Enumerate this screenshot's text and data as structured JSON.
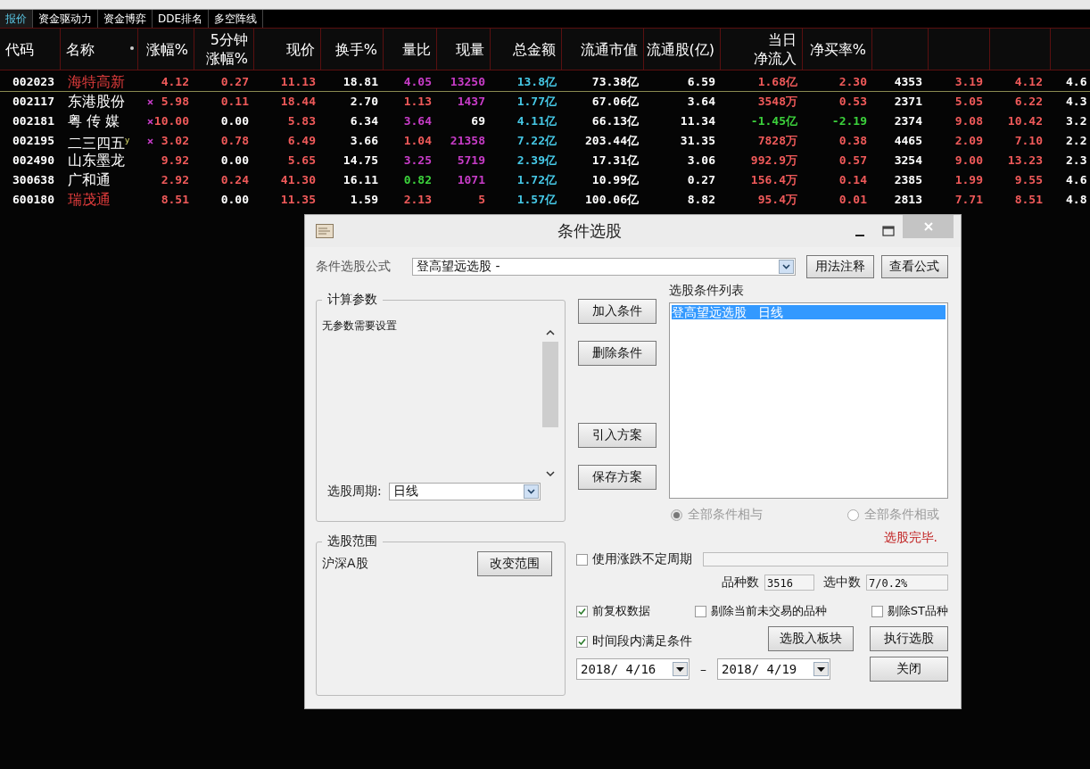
{
  "tabs": [
    {
      "label": "报价",
      "selected": true
    },
    {
      "label": "资金驱动力",
      "selected": false
    },
    {
      "label": "资金博弈",
      "selected": false
    },
    {
      "label": "DDE排名",
      "selected": false
    },
    {
      "label": "多空阵线",
      "selected": false
    }
  ],
  "table": {
    "columns": [
      {
        "lines": [
          "代码"
        ],
        "sorted": false
      },
      {
        "lines": [
          "名称"
        ],
        "sorted": true
      },
      {
        "lines": [
          "涨幅%"
        ],
        "sorted": false
      },
      {
        "lines": [
          "5分钟",
          "涨幅%"
        ],
        "sorted": false
      },
      {
        "lines": [
          "现价"
        ],
        "sorted": false
      },
      {
        "lines": [
          "换手%"
        ],
        "sorted": false
      },
      {
        "lines": [
          "量比"
        ],
        "sorted": false
      },
      {
        "lines": [
          "现量"
        ],
        "sorted": false
      },
      {
        "lines": [
          "总金额"
        ],
        "sorted": false
      },
      {
        "lines": [
          "流通市值"
        ],
        "sorted": false
      },
      {
        "lines": [
          "流通股(亿)"
        ],
        "sorted": false
      },
      {
        "lines": [
          "当日",
          "净流入"
        ],
        "sorted": false
      },
      {
        "lines": [
          "净买率%"
        ],
        "sorted": false
      }
    ],
    "rows": [
      {
        "marked": false,
        "selected": true,
        "cells": [
          {
            "text": "002023",
            "color": "#ffffff"
          },
          {
            "text": "海特高新",
            "color": "#e03c3c"
          },
          {
            "text": "4.12",
            "color": "#f05a5a"
          },
          {
            "text": "0.27",
            "color": "#f05a5a"
          },
          {
            "text": "11.13",
            "color": "#f05a5a"
          },
          {
            "text": "18.81",
            "color": "#ffffff"
          },
          {
            "text": "4.05",
            "color": "#c83cc8"
          },
          {
            "text": "13250",
            "color": "#c83cc8"
          },
          {
            "text": "13.8亿",
            "color": "#46c8e6"
          },
          {
            "text": "73.38亿",
            "color": "#ffffff"
          },
          {
            "text": "6.59",
            "color": "#ffffff"
          },
          {
            "text": "1.68亿",
            "color": "#f05a5a"
          },
          {
            "text": "2.30",
            "color": "#f05a5a"
          },
          {
            "text": "4353",
            "color": "#ffffff"
          },
          {
            "text": "3.19",
            "color": "#f05a5a"
          },
          {
            "text": "4.12",
            "color": "#f05a5a"
          },
          {
            "text": "4.6",
            "color": "#ffffff"
          }
        ]
      },
      {
        "marked": true,
        "selected": false,
        "cells": [
          {
            "text": "002117",
            "color": "#ffffff"
          },
          {
            "text": "东港股份",
            "color": "#ffffff"
          },
          {
            "text": "5.98",
            "color": "#f05a5a"
          },
          {
            "text": "0.11",
            "color": "#f05a5a"
          },
          {
            "text": "18.44",
            "color": "#f05a5a"
          },
          {
            "text": "2.70",
            "color": "#ffffff"
          },
          {
            "text": "1.13",
            "color": "#f05a5a"
          },
          {
            "text": "1437",
            "color": "#c83cc8"
          },
          {
            "text": "1.77亿",
            "color": "#46c8e6"
          },
          {
            "text": "67.06亿",
            "color": "#ffffff"
          },
          {
            "text": "3.64",
            "color": "#ffffff"
          },
          {
            "text": "3548万",
            "color": "#f05a5a"
          },
          {
            "text": "0.53",
            "color": "#f05a5a"
          },
          {
            "text": "2371",
            "color": "#ffffff"
          },
          {
            "text": "5.05",
            "color": "#f05a5a"
          },
          {
            "text": "6.22",
            "color": "#f05a5a"
          },
          {
            "text": "4.3",
            "color": "#ffffff"
          }
        ]
      },
      {
        "marked": true,
        "selected": false,
        "cells": [
          {
            "text": "002181",
            "color": "#ffffff"
          },
          {
            "text": "粤 传 媒",
            "color": "#ffffff"
          },
          {
            "text": "10.00",
            "color": "#f05a5a"
          },
          {
            "text": "0.00",
            "color": "#ffffff"
          },
          {
            "text": "5.83",
            "color": "#f05a5a"
          },
          {
            "text": "6.34",
            "color": "#ffffff"
          },
          {
            "text": "3.64",
            "color": "#c83cc8"
          },
          {
            "text": "69",
            "color": "#ffffff"
          },
          {
            "text": "4.11亿",
            "color": "#46c8e6"
          },
          {
            "text": "66.13亿",
            "color": "#ffffff"
          },
          {
            "text": "11.34",
            "color": "#ffffff"
          },
          {
            "text": "-1.45亿",
            "color": "#3cd23c"
          },
          {
            "text": "-2.19",
            "color": "#3cd23c"
          },
          {
            "text": "2374",
            "color": "#ffffff"
          },
          {
            "text": "9.08",
            "color": "#f05a5a"
          },
          {
            "text": "10.42",
            "color": "#f05a5a"
          },
          {
            "text": "3.2",
            "color": "#ffffff"
          }
        ]
      },
      {
        "marked": true,
        "selected": false,
        "cells": [
          {
            "text": "002195",
            "color": "#ffffff"
          },
          {
            "text": "二三四五$^{y}$",
            "color": "#ffffff"
          },
          {
            "text": "3.02",
            "color": "#f05a5a"
          },
          {
            "text": "0.78",
            "color": "#f05a5a"
          },
          {
            "text": "6.49",
            "color": "#f05a5a"
          },
          {
            "text": "3.66",
            "color": "#ffffff"
          },
          {
            "text": "1.04",
            "color": "#f05a5a"
          },
          {
            "text": "21358",
            "color": "#c83cc8"
          },
          {
            "text": "7.22亿",
            "color": "#46c8e6"
          },
          {
            "text": "203.44亿",
            "color": "#ffffff"
          },
          {
            "text": "31.35",
            "color": "#ffffff"
          },
          {
            "text": "7828万",
            "color": "#f05a5a"
          },
          {
            "text": "0.38",
            "color": "#f05a5a"
          },
          {
            "text": "4465",
            "color": "#ffffff"
          },
          {
            "text": "2.09",
            "color": "#f05a5a"
          },
          {
            "text": "7.10",
            "color": "#f05a5a"
          },
          {
            "text": "2.2",
            "color": "#ffffff"
          }
        ]
      },
      {
        "marked": false,
        "selected": false,
        "cells": [
          {
            "text": "002490",
            "color": "#ffffff"
          },
          {
            "text": "山东墨龙",
            "color": "#ffffff"
          },
          {
            "text": "9.92",
            "color": "#f05a5a"
          },
          {
            "text": "0.00",
            "color": "#ffffff"
          },
          {
            "text": "5.65",
            "color": "#f05a5a"
          },
          {
            "text": "14.75",
            "color": "#ffffff"
          },
          {
            "text": "3.25",
            "color": "#c83cc8"
          },
          {
            "text": "5719",
            "color": "#c83cc8"
          },
          {
            "text": "2.39亿",
            "color": "#46c8e6"
          },
          {
            "text": "17.31亿",
            "color": "#ffffff"
          },
          {
            "text": "3.06",
            "color": "#ffffff"
          },
          {
            "text": "992.9万",
            "color": "#f05a5a"
          },
          {
            "text": "0.57",
            "color": "#f05a5a"
          },
          {
            "text": "3254",
            "color": "#ffffff"
          },
          {
            "text": "9.00",
            "color": "#f05a5a"
          },
          {
            "text": "13.23",
            "color": "#f05a5a"
          },
          {
            "text": "2.3",
            "color": "#ffffff"
          }
        ]
      },
      {
        "marked": false,
        "selected": false,
        "cells": [
          {
            "text": "300638",
            "color": "#ffffff"
          },
          {
            "text": "广和通",
            "color": "#ffffff"
          },
          {
            "text": "2.92",
            "color": "#f05a5a"
          },
          {
            "text": "0.24",
            "color": "#f05a5a"
          },
          {
            "text": "41.30",
            "color": "#f05a5a"
          },
          {
            "text": "16.11",
            "color": "#ffffff"
          },
          {
            "text": "0.82",
            "color": "#3cd23c"
          },
          {
            "text": "1071",
            "color": "#c83cc8"
          },
          {
            "text": "1.72亿",
            "color": "#46c8e6"
          },
          {
            "text": "10.99亿",
            "color": "#ffffff"
          },
          {
            "text": "0.27",
            "color": "#ffffff"
          },
          {
            "text": "156.4万",
            "color": "#f05a5a"
          },
          {
            "text": "0.14",
            "color": "#f05a5a"
          },
          {
            "text": "2385",
            "color": "#ffffff"
          },
          {
            "text": "1.99",
            "color": "#f05a5a"
          },
          {
            "text": "9.55",
            "color": "#f05a5a"
          },
          {
            "text": "4.6",
            "color": "#ffffff"
          }
        ]
      },
      {
        "marked": false,
        "selected": false,
        "cells": [
          {
            "text": "600180",
            "color": "#ffffff"
          },
          {
            "text": "瑞茂通",
            "color": "#e03c3c"
          },
          {
            "text": "8.51",
            "color": "#f05a5a"
          },
          {
            "text": "0.00",
            "color": "#ffffff"
          },
          {
            "text": "11.35",
            "color": "#f05a5a"
          },
          {
            "text": "1.59",
            "color": "#ffffff"
          },
          {
            "text": "2.13",
            "color": "#f05a5a"
          },
          {
            "text": "5",
            "color": "#f05a5a"
          },
          {
            "text": "1.57亿",
            "color": "#46c8e6"
          },
          {
            "text": "100.06亿",
            "color": "#ffffff"
          },
          {
            "text": "8.82",
            "color": "#ffffff"
          },
          {
            "text": "95.4万",
            "color": "#f05a5a"
          },
          {
            "text": "0.01",
            "color": "#f05a5a"
          },
          {
            "text": "2813",
            "color": "#ffffff"
          },
          {
            "text": "7.71",
            "color": "#f05a5a"
          },
          {
            "text": "8.51",
            "color": "#f05a5a"
          },
          {
            "text": "4.8",
            "color": "#ffffff"
          }
        ]
      }
    ]
  },
  "dialog": {
    "title": "条件选股",
    "formula": {
      "label": "条件选股公式",
      "value": "登高望远选股 -"
    },
    "top_buttons": [
      "用法注释",
      "查看公式"
    ],
    "params": {
      "title": "计算参数",
      "text": "无参数需要设置",
      "period_label": "选股周期:",
      "period_value": "日线"
    },
    "scope": {
      "title": "选股范围",
      "value": "沪深A股",
      "button": "改变范围"
    },
    "middle_buttons": [
      "加入条件",
      "删除条件",
      "引入方案",
      "保存方案"
    ],
    "conditions": {
      "title": "选股条件列表",
      "items": [
        {
          "label": "登高望远选股",
          "period": "日线",
          "selected": true
        }
      ]
    },
    "radios": [
      {
        "label": "全部条件相与",
        "selected": true,
        "disabled": true
      },
      {
        "label": "全部条件相或",
        "selected": false,
        "disabled": true
      }
    ],
    "status": "选股完毕.",
    "float_period": {
      "label": "使用涨跌不定周期",
      "checked": false
    },
    "counts": [
      {
        "label": "品种数",
        "value": "3516"
      },
      {
        "label": "选中数",
        "value": "7/0.2%"
      }
    ],
    "options": [
      {
        "label": "前复权数据",
        "checked": true
      },
      {
        "label": "剔除当前未交易的品种",
        "checked": false
      },
      {
        "label": "剔除ST品种",
        "checked": false
      }
    ],
    "time_range": {
      "label": "时间段内满足条件",
      "checked": true,
      "from": "2018/ 4/16",
      "separator": "–",
      "to": "2018/ 4/19"
    },
    "bottom_buttons": [
      "选股入板块",
      "执行选股",
      "关闭"
    ]
  }
}
